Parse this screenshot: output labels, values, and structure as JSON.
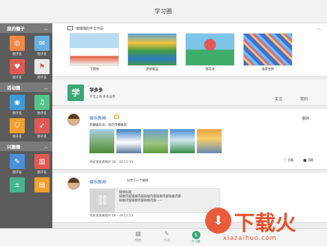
{
  "app": {
    "title": "学习圈"
  },
  "sidebar": {
    "sections": [
      {
        "label": "我的圈子",
        "items": [
          {
            "label": "圈子名",
            "icon": "lifebuoy-icon",
            "color": "#f08a48"
          },
          {
            "label": "圈子名",
            "icon": "mail-icon",
            "color": "#6ab0e2"
          },
          {
            "label": "圈子名",
            "icon": "heart-icon",
            "color": "#e05a55"
          },
          {
            "label": "圈子名",
            "icon": "flag-icon",
            "color": "#e9e9e9"
          }
        ]
      },
      {
        "label": "活动圈",
        "items": [
          {
            "label": "圈子名",
            "icon": "camera-icon",
            "color": "#3f9bd6"
          },
          {
            "label": "圈子名",
            "icon": "music-icon",
            "color": "#56c38a"
          },
          {
            "label": "圈子名",
            "icon": "shield-icon",
            "color": "#f0a030"
          },
          {
            "label": "圈子名",
            "icon": "rocket-icon",
            "color": "#e05a55"
          }
        ]
      },
      {
        "label": "兴趣圈",
        "items": [
          {
            "label": "圈子名",
            "icon": "edit-icon",
            "color": "#4a8fd8"
          },
          {
            "label": "圈子名",
            "icon": "chart-icon",
            "color": "#e05a55"
          },
          {
            "label": "",
            "icon": "calculator-icon",
            "color": "#48b38f"
          },
          {
            "label": "",
            "icon": "book-icon",
            "color": "#f0a030"
          }
        ]
      }
    ]
  },
  "works": {
    "title": "瑞瑞瑞的手工作品",
    "items": [
      {
        "caption": "下雪啦",
        "colors": [
          "#b6dcf2",
          "#e25a3a",
          "#ffffff"
        ]
      },
      {
        "caption": "梦想家园",
        "colors": [
          "#56a6d8",
          "#3f9a45",
          "#f2c23b"
        ]
      },
      {
        "caption": "荷花池",
        "colors": [
          "#7cc4e8",
          "#e05a55",
          "#3fae6a"
        ]
      },
      {
        "caption": "海底世界",
        "colors": [
          "#4c6bd3",
          "#e9d24a",
          "#e05ab0"
        ]
      }
    ]
  },
  "profile": {
    "logo_char": "学",
    "name": "学多多",
    "subtitle": "学无止境 多多益善",
    "follow_label": "关注",
    "back_label": "我的"
  },
  "posts": [
    {
      "author": "娱乐新闻",
      "delete_label": "删除",
      "text": "热播娱乐讯，就在传播报道",
      "images": [
        "#7fb07a",
        "#3e7fc2",
        "#9ec37c",
        "#6aa0d0",
        "#e8a040"
      ],
      "meta": "肖好发发表照片  06 - 29 11:15",
      "likes": "08",
      "comments": "08"
    },
    {
      "author": "娱乐新闻",
      "share_text": "分享了一个链接",
      "link_title": "链接标题",
      "link_lines": [
        "链接内容链接内容链接内容链接内容链接内容",
        "链接内容链接内容链接内容······"
      ],
      "meta": "肖好发发表照片  06 - 29 11:15"
    }
  ],
  "tabs": [
    {
      "label": "圈圈",
      "icon": "building-icon",
      "active": false
    },
    {
      "label": "作业",
      "icon": "pencil-icon",
      "active": false
    },
    {
      "label": "学习圈",
      "icon": "dollar-icon",
      "active": true
    }
  ],
  "watermark": {
    "text": "下载火",
    "url": "xiazaihuo.com"
  }
}
